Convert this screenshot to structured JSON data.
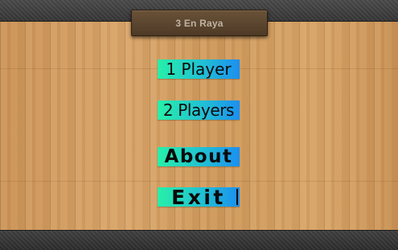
{
  "header": {
    "title": "3 En Raya"
  },
  "menu": {
    "items": [
      {
        "label": "1 Player"
      },
      {
        "label": "2 Players"
      },
      {
        "label": "About"
      },
      {
        "label": "Exit"
      }
    ]
  },
  "colors": {
    "button_gradient_start": "#27f0a8",
    "button_gradient_end": "#1b8ff0",
    "title_plate": "#5c4530",
    "wood": "#cf9a5e",
    "bars": "#3a3a3a"
  }
}
